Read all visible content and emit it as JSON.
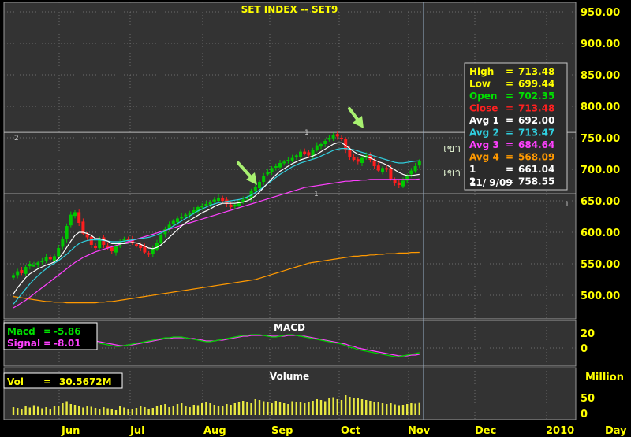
{
  "title": "SET  INDEX  --  SET9",
  "colors": {
    "bg_plot": "#333333",
    "grid": "#6e6e6e",
    "frame": "#9a9a9a",
    "axis_text": "#ffff00",
    "up": "#00c800",
    "down": "#ff1e1e",
    "avg1": "#ffffff",
    "avg2": "#30d0e0",
    "avg3": "#ff40ff",
    "avg4": "#ff9900",
    "macd": "#00d000",
    "signal": "#ff40ff",
    "volume": "#e8e840"
  },
  "info_box": {
    "rows": [
      {
        "label": "High",
        "eq": "=",
        "value": "713.48",
        "color": "#ffff00"
      },
      {
        "label": "Low",
        "eq": "=",
        "value": "699.44",
        "color": "#ffff00"
      },
      {
        "label": "Open",
        "eq": "=",
        "value": "702.35",
        "color": "#00e000"
      },
      {
        "label": "Close",
        "eq": "=",
        "value": "713.48",
        "color": "#ff2020"
      },
      {
        "label": "Avg  1",
        "eq": "=",
        "value": "692.00",
        "color": "#ffffff"
      },
      {
        "label": "Avg  2",
        "eq": "=",
        "value": "713.47",
        "color": "#30d0e0"
      },
      {
        "label": "Avg  3",
        "eq": "=",
        "value": "684.64",
        "color": "#ff40ff"
      },
      {
        "label": "Avg  4",
        "eq": "=",
        "value": "568.09",
        "color": "#ff9900"
      },
      {
        "label": " 1",
        "eq": "=",
        "value": "661.04",
        "color": "#ffffff"
      },
      {
        "label": " 2",
        "eq": "=",
        "value": "758.55",
        "color": "#ffffff"
      }
    ],
    "date": "11/ 9/09"
  },
  "thai_labels": [
    "เขา",
    "เขา"
  ],
  "level_markers": {
    "left": "2",
    "mid_upper": "1",
    "mid_lower": "1",
    "right": "1"
  },
  "macd_panel": {
    "title": "MACD",
    "macd_label": "Macd",
    "macd_value": "-5.86",
    "signal_label": "Signal",
    "signal_value": "-8.01",
    "ticks": [
      "20",
      "0"
    ]
  },
  "volume_panel": {
    "title": "Volume",
    "vol_label": "Vol",
    "vol_value": "30.5672M",
    "unit": "Million",
    "ticks": [
      "50",
      "0"
    ]
  },
  "x_unit": "Day",
  "chart_data": {
    "type": "candlestick",
    "title": "SET  INDEX  --  SET9",
    "y_ticks": [
      "950.00",
      "900.00",
      "850.00",
      "800.00",
      "750.00",
      "700.00",
      "650.00",
      "600.00",
      "550.00",
      "500.00"
    ],
    "ylim": [
      459,
      961
    ],
    "x_month_labels": [
      "Jun",
      "Jul",
      "Aug",
      "Sep",
      "Oct",
      "Nov",
      "Dec",
      "2010"
    ],
    "horizontal_levels": [
      758.55,
      661.04
    ],
    "close_series": [
      532,
      538,
      535,
      545,
      550,
      548,
      552,
      555,
      560,
      557,
      562,
      575,
      590,
      610,
      628,
      632,
      615,
      598,
      592,
      580,
      575,
      590,
      580,
      575,
      570,
      578,
      585,
      590,
      588,
      583,
      580,
      575,
      568,
      565,
      575,
      583,
      595,
      605,
      612,
      618,
      622,
      625,
      628,
      630,
      635,
      640,
      642,
      645,
      648,
      652,
      655,
      650,
      645,
      640,
      644,
      648,
      652,
      655,
      665,
      672,
      680,
      690,
      696,
      702,
      705,
      710,
      712,
      715,
      718,
      722,
      728,
      725,
      722,
      730,
      738,
      740,
      745,
      750,
      755,
      752,
      748,
      730,
      720,
      715,
      712,
      718,
      722,
      715,
      705,
      698,
      702,
      700,
      685,
      678,
      675,
      682,
      690,
      698,
      705,
      713
    ],
    "avg1": [
      502,
      512,
      520,
      528,
      534,
      538,
      542,
      545,
      548,
      550,
      553,
      558,
      566,
      576,
      586,
      595,
      600,
      600,
      598,
      595,
      590,
      590,
      588,
      586,
      582,
      582,
      582,
      582,
      583,
      584,
      583,
      581,
      578,
      575,
      574,
      576,
      580,
      586,
      592,
      598,
      604,
      610,
      615,
      619,
      623,
      627,
      631,
      634,
      637,
      641,
      644,
      646,
      646,
      646,
      646,
      647,
      648,
      650,
      653,
      658,
      664,
      671,
      678,
      685,
      691,
      697,
      701,
      705,
      709,
      712,
      715,
      717,
      719,
      721,
      724,
      728,
      732,
      736,
      740,
      742,
      742,
      738,
      733,
      728,
      724,
      722,
      720,
      718,
      715,
      712,
      710,
      707,
      703,
      699,
      695,
      692,
      690,
      690,
      691,
      692
    ],
    "avg2": [
      486,
      494,
      502,
      510,
      518,
      525,
      531,
      537,
      542,
      547,
      551,
      555,
      560,
      565,
      571,
      577,
      582,
      585,
      587,
      588,
      588,
      588,
      587,
      586,
      585,
      585,
      585,
      586,
      587,
      588,
      589,
      590,
      591,
      592,
      594,
      596,
      599,
      602,
      606,
      610,
      614,
      618,
      622,
      626,
      630,
      634,
      637,
      640,
      643,
      645,
      647,
      648,
      649,
      650,
      651,
      652,
      654,
      656,
      659,
      663,
      667,
      672,
      677,
      682,
      687,
      692,
      696,
      700,
      704,
      707,
      710,
      712,
      714,
      716,
      718,
      721,
      724,
      727,
      730,
      732,
      733,
      733,
      732,
      731,
      729,
      727,
      725,
      723,
      721,
      719,
      717,
      715,
      713,
      711,
      710,
      710,
      711,
      712,
      713,
      713.47
    ],
    "avg3": [
      480,
      484,
      488,
      492,
      497,
      502,
      507,
      512,
      517,
      522,
      527,
      532,
      537,
      542,
      547,
      552,
      556,
      560,
      563,
      566,
      569,
      571,
      573,
      575,
      577,
      579,
      581,
      583,
      585,
      587,
      589,
      591,
      593,
      595,
      597,
      599,
      601,
      603,
      605,
      607,
      609,
      611,
      613,
      615,
      617,
      619,
      621,
      623,
      625,
      627,
      629,
      631,
      633,
      635,
      637,
      639,
      641,
      643,
      645,
      647,
      649,
      651,
      653,
      655,
      657,
      659,
      661,
      663,
      665,
      667,
      669,
      671,
      672,
      673,
      674,
      675,
      676,
      677,
      678,
      679,
      680,
      681,
      681,
      682,
      682,
      683,
      683,
      684,
      684,
      684,
      684,
      684,
      684,
      684,
      684,
      684,
      684,
      684,
      684,
      684.64
    ],
    "avg4": [
      498,
      497,
      496,
      495,
      494,
      493,
      492,
      491,
      490,
      490,
      489,
      489,
      489,
      488,
      488,
      488,
      488,
      488,
      488,
      488,
      488,
      489,
      489,
      490,
      490,
      491,
      492,
      493,
      494,
      495,
      496,
      497,
      498,
      499,
      500,
      501,
      502,
      503,
      504,
      505,
      506,
      507,
      508,
      509,
      510,
      511,
      512,
      513,
      514,
      515,
      516,
      517,
      518,
      519,
      520,
      521,
      522,
      523,
      524,
      525,
      527,
      529,
      531,
      533,
      535,
      537,
      539,
      541,
      543,
      545,
      547,
      549,
      551,
      552,
      553,
      554,
      555,
      556,
      557,
      558,
      559,
      560,
      561,
      562,
      562,
      563,
      563,
      564,
      564,
      565,
      565,
      566,
      566,
      566,
      567,
      567,
      567,
      568,
      568,
      568.09
    ],
    "macd": [
      12,
      13,
      14,
      14,
      13,
      12,
      10,
      8,
      6,
      5,
      4,
      4,
      5,
      6,
      8,
      10,
      11,
      12,
      11,
      10,
      8,
      6,
      5,
      4,
      3,
      2,
      2,
      3,
      4,
      5,
      6,
      7,
      8,
      9,
      10,
      11,
      12,
      13,
      13,
      14,
      14,
      14,
      13,
      12,
      11,
      10,
      9,
      8,
      8,
      9,
      10,
      11,
      12,
      13,
      14,
      15,
      16,
      16,
      17,
      17,
      17,
      16,
      15,
      14,
      14,
      15,
      16,
      17,
      17,
      16,
      15,
      14,
      13,
      12,
      11,
      10,
      9,
      8,
      7,
      6,
      5,
      3,
      1,
      0,
      -2,
      -3,
      -4,
      -5,
      -6,
      -7,
      -8,
      -9,
      -10,
      -11,
      -11,
      -10,
      -9,
      -8,
      -7,
      -5.86
    ],
    "signal": [
      11,
      12,
      13,
      13,
      13,
      12,
      11,
      10,
      8,
      7,
      6,
      5,
      5,
      6,
      7,
      8,
      9,
      10,
      10,
      10,
      9,
      8,
      7,
      6,
      5,
      4,
      3,
      3,
      4,
      4,
      5,
      6,
      7,
      8,
      9,
      10,
      11,
      12,
      12,
      13,
      13,
      13,
      13,
      12,
      12,
      11,
      10,
      9,
      9,
      9,
      10,
      10,
      11,
      12,
      13,
      14,
      15,
      15,
      16,
      16,
      16,
      16,
      16,
      15,
      15,
      15,
      15,
      16,
      16,
      16,
      15,
      15,
      14,
      13,
      12,
      11,
      10,
      9,
      8,
      7,
      6,
      5,
      3,
      2,
      0,
      -1,
      -2,
      -3,
      -4,
      -5,
      -6,
      -7,
      -8,
      -9,
      -10,
      -10,
      -10,
      -9,
      -9,
      -8.01
    ],
    "volume_millions": [
      20,
      18,
      15,
      22,
      19,
      25,
      21,
      17,
      20,
      16,
      24,
      22,
      30,
      35,
      28,
      26,
      22,
      19,
      24,
      21,
      18,
      15,
      20,
      17,
      14,
      12,
      22,
      19,
      16,
      14,
      18,
      24,
      20,
      16,
      18,
      22,
      26,
      28,
      20,
      24,
      28,
      30,
      22,
      20,
      26,
      25,
      30,
      34,
      30,
      26,
      22,
      24,
      28,
      26,
      30,
      32,
      36,
      33,
      30,
      40,
      38,
      35,
      32,
      30,
      36,
      34,
      30,
      28,
      35,
      32,
      33,
      30,
      34,
      36,
      40,
      38,
      35,
      42,
      45,
      40,
      38,
      50,
      46,
      44,
      42,
      40,
      38,
      36,
      34,
      32,
      30,
      28,
      30,
      27,
      25,
      26,
      28,
      30,
      29,
      30.57
    ]
  }
}
